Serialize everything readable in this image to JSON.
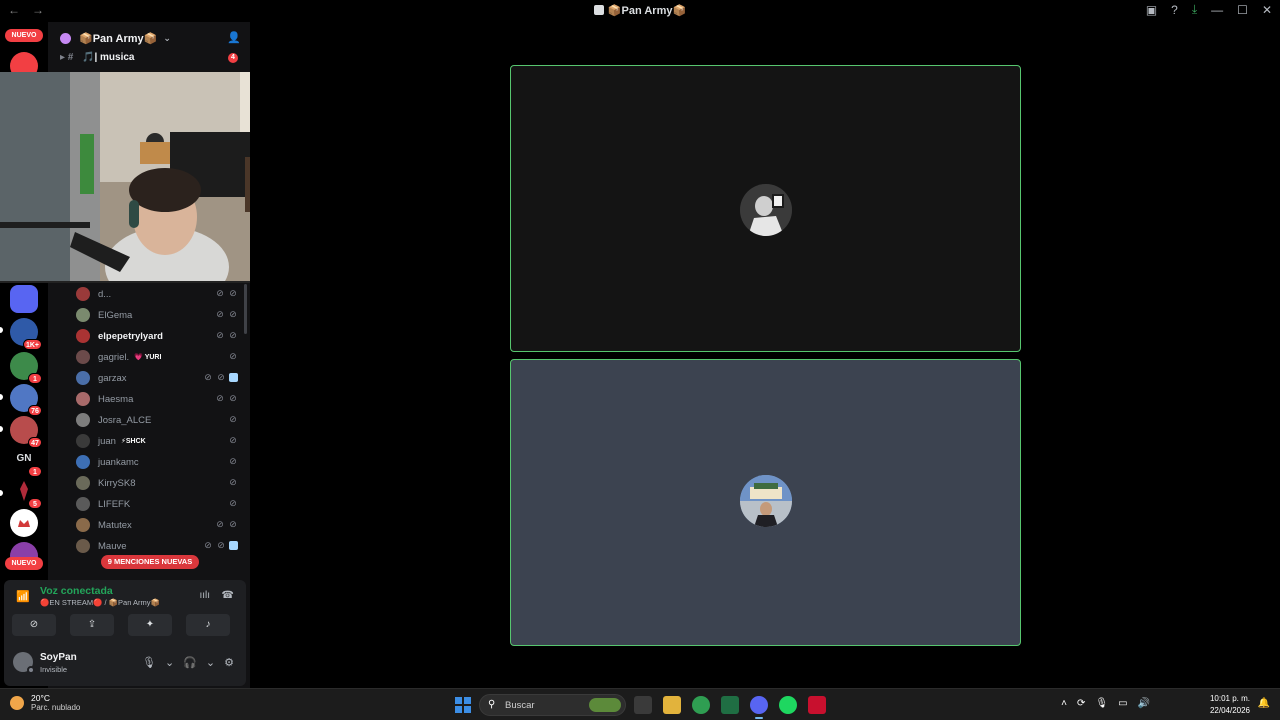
{
  "window": {
    "title": "📦Pan Army📦"
  },
  "rail": {
    "top_pill": "NUEVO",
    "bottom_pill": "NUEVO",
    "servers": [
      {
        "badge": "1K+"
      },
      {
        "badge": "1"
      },
      {
        "badge": "76"
      },
      {
        "badge": "47"
      },
      {
        "label": "GN",
        "badge": "1"
      },
      {
        "badge": "5"
      }
    ]
  },
  "server": {
    "name": "📦Pan Army📦",
    "channel": {
      "name": "🎵| musica",
      "count": "4"
    }
  },
  "members": [
    {
      "name": "d...",
      "tag": ""
    },
    {
      "name": "ElGema",
      "tag": ""
    },
    {
      "name": "elpepetrylyard",
      "tag": ""
    },
    {
      "name": "gagriel.",
      "tag": "💗 YURI"
    },
    {
      "name": "garzax",
      "tag": ""
    },
    {
      "name": "Haesma",
      "tag": ""
    },
    {
      "name": "Josra_ALCE",
      "tag": ""
    },
    {
      "name": "juan",
      "tag": "⚡SHCK"
    },
    {
      "name": "juankamc",
      "tag": ""
    },
    {
      "name": "KirrySK8",
      "tag": ""
    },
    {
      "name": "LIFEFK",
      "tag": ""
    },
    {
      "name": "Matutex",
      "tag": ""
    },
    {
      "name": "Mauve",
      "tag": ""
    }
  ],
  "new_mentions": "9 MENCIONES NUEVAS",
  "voice": {
    "status": "Voz conectada",
    "detail": "🔴EN STREAM🔴 / 📦Pan Army📦"
  },
  "user": {
    "name": "SoyPan",
    "status": "Invisible"
  },
  "taskbar": {
    "temperature": "20°C",
    "weather": "Parc. nublado",
    "search_placeholder": "Buscar",
    "time": "10:01 p. m.",
    "date": "22/04/2026"
  },
  "colors": {
    "speaking_border": "#57c66f",
    "voice_connected": "#23a55a",
    "badge_red": "#f23f43",
    "tile_dark": "#141414",
    "tile_slate": "#3c4350"
  }
}
